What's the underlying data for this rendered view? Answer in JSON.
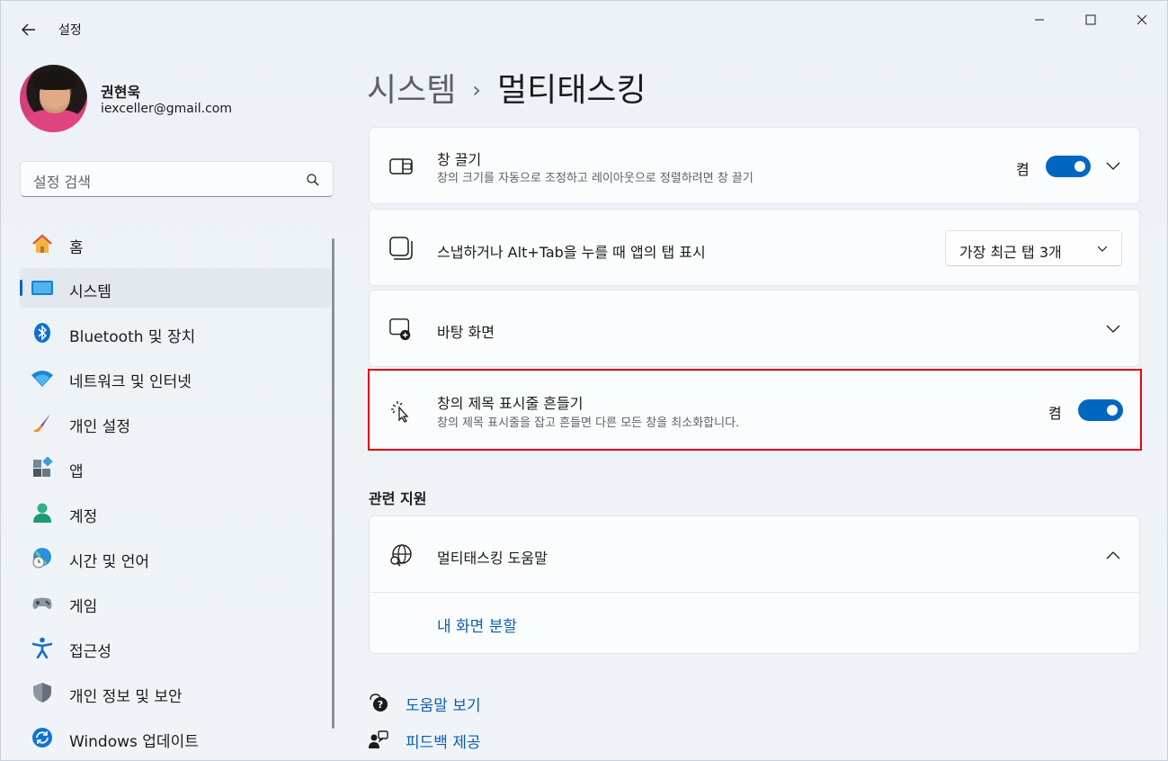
{
  "window": {
    "title": "설정"
  },
  "profile": {
    "name": "권현욱",
    "email": "iexceller@gmail.com"
  },
  "search": {
    "placeholder": "설정 검색"
  },
  "nav": {
    "items": [
      {
        "label": "홈",
        "icon": "home-icon"
      },
      {
        "label": "시스템",
        "icon": "system-icon",
        "active": true
      },
      {
        "label": "Bluetooth 및 장치",
        "icon": "bluetooth-icon"
      },
      {
        "label": "네트워크 및 인터넷",
        "icon": "wifi-icon"
      },
      {
        "label": "개인 설정",
        "icon": "brush-icon"
      },
      {
        "label": "앱",
        "icon": "apps-icon"
      },
      {
        "label": "계정",
        "icon": "account-icon"
      },
      {
        "label": "시간 및 언어",
        "icon": "globe-clock-icon"
      },
      {
        "label": "게임",
        "icon": "gamepad-icon"
      },
      {
        "label": "접근성",
        "icon": "accessibility-icon"
      },
      {
        "label": "개인 정보 및 보안",
        "icon": "shield-icon"
      },
      {
        "label": "Windows 업데이트",
        "icon": "update-icon"
      }
    ]
  },
  "breadcrumb": {
    "parent": "시스템",
    "separator": "›",
    "current": "멀티태스킹"
  },
  "cards": {
    "snap": {
      "title": "창 끌기",
      "subtitle": "창의 크기를 자동으로 조정하고 레이아웃으로 정렬하려면 창 끌기",
      "state": "켬"
    },
    "alttab": {
      "title": "스냅하거나 Alt+Tab을 누를 때 앱의 탭 표시",
      "value": "가장 최근 탭 3개"
    },
    "desktops": {
      "title": "바탕 화면"
    },
    "shake": {
      "title": "창의 제목 표시줄 흔들기",
      "subtitle": "창의 제목 표시줄을 잡고 흔들면 다른 모든 창을 최소화합니다.",
      "state": "켬"
    }
  },
  "related": {
    "section_title": "관련 지원",
    "help_title": "멀티태스킹 도움말",
    "link": "내 화면 분할"
  },
  "footer": {
    "help": "도움말 보기",
    "feedback": "피드백 제공"
  },
  "colors": {
    "accent": "#0067c0",
    "highlight": "#e00c18",
    "link": "#0a5fb0"
  }
}
